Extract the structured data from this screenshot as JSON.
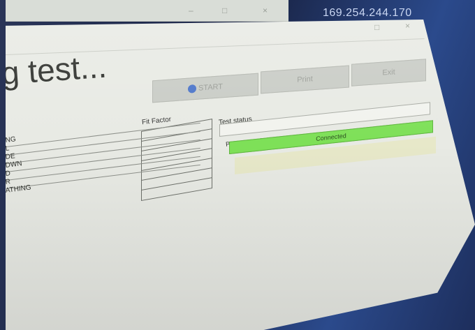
{
  "background": {
    "ip_address": "169.254.244.170"
  },
  "window": {
    "controls": {
      "minimize": "–",
      "maximize": "□",
      "close": "×"
    },
    "heading": "g test..."
  },
  "toolbar": {
    "start_label": "START",
    "print_label": "Print",
    "exit_label": "Exit"
  },
  "results": {
    "fit_factor_header": "Fit Factor",
    "exercises": [
      "NG",
      "L",
      "DE",
      "DWN",
      "D",
      "R",
      "ATHING"
    ]
  },
  "status": {
    "test_status_label": "Test status",
    "test_status_value": "",
    "portacount_label": "PortaCount Status",
    "portacount_value": "Connected"
  },
  "colors": {
    "connected_green": "#7ee058",
    "window_bg": "#e8eae4"
  }
}
